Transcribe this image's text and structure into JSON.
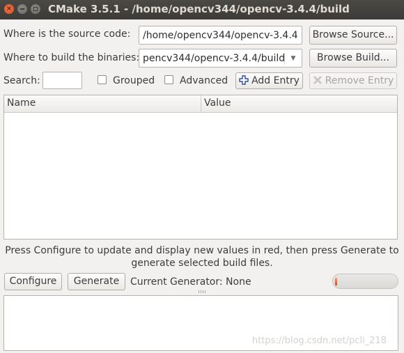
{
  "window": {
    "title": "CMake 3.5.1 - /home/opencv344/opencv-3.4.4/build",
    "close_glyph": "×"
  },
  "source": {
    "label": "Where is the source code:",
    "value": "/home/opencv344/opencv-3.4.4",
    "browse_label": "Browse Source..."
  },
  "build": {
    "label": "Where to build the binaries:",
    "value": "pencv344/opencv-3.4.4/build",
    "browse_label": "Browse Build..."
  },
  "toolbar": {
    "search_label": "Search:",
    "search_value": "",
    "grouped_label": "Grouped",
    "advanced_label": "Advanced",
    "add_entry_label": "Add Entry",
    "remove_entry_label": "Remove Entry"
  },
  "table": {
    "columns": [
      "Name",
      "Value"
    ]
  },
  "status": {
    "message": "Press Configure to update and display new values in red, then press Generate to generate selected build files."
  },
  "actions": {
    "configure_label": "Configure",
    "generate_label": "Generate",
    "generator_text": "Current Generator: None",
    "progress": 0.04
  },
  "watermark": "https://blog.csdn.net/pcli_218",
  "colors": {
    "accent": "#d9481c",
    "titlebar": "#3c3b37"
  }
}
